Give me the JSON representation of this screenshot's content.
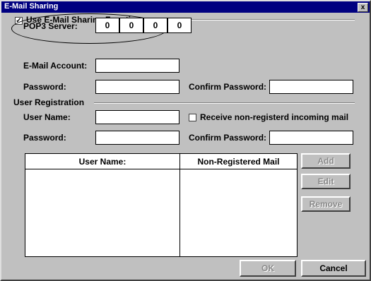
{
  "window": {
    "title": "E-Mail Sharing",
    "close_glyph": "x"
  },
  "use_sharing": {
    "label": "Use E-Mail Sharing Function",
    "checked": true,
    "check_glyph": "✓"
  },
  "pop3": {
    "label": "POP3 Server:",
    "octets": [
      "0",
      "0",
      "0",
      "0"
    ]
  },
  "email_account": {
    "label": "E-Mail Account:",
    "value": ""
  },
  "password": {
    "label": "Password:",
    "value": ""
  },
  "confirm_password": {
    "label": "Confirm Password:",
    "value": ""
  },
  "user_registration": {
    "group_label": "User Registration",
    "user_name_label": "User Name:",
    "receive_label": "Receive non-registerd incoming mail",
    "receive_checked": false,
    "password_label": "Password:",
    "confirm_password_label": "Confirm Password:"
  },
  "list": {
    "columns": [
      "User Name:",
      "Non-Registered Mail"
    ],
    "rows": []
  },
  "buttons": {
    "add": "Add",
    "edit": "Edit",
    "remove": "Remove",
    "ok": "OK",
    "cancel": "Cancel"
  }
}
